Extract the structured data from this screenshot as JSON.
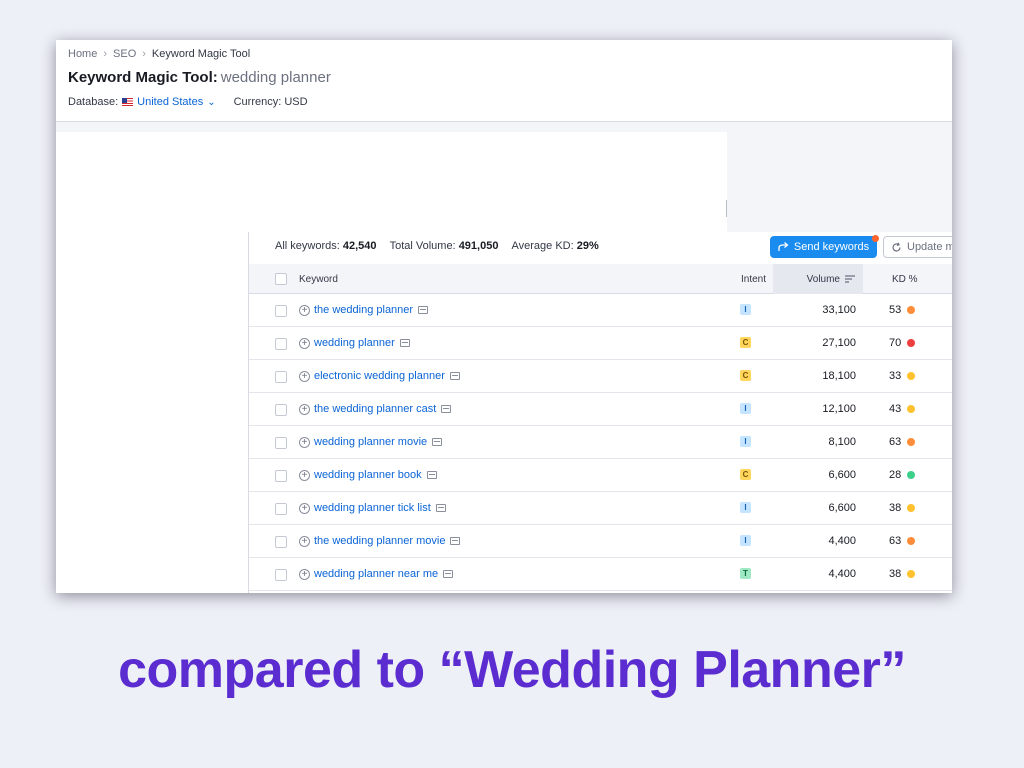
{
  "breadcrumb": [
    "Home",
    "SEO",
    "Keyword Magic Tool"
  ],
  "title": {
    "label": "Keyword Magic Tool:",
    "query": "wedding planner"
  },
  "database": {
    "label": "Database:",
    "value": "United States",
    "currency": "Currency: USD"
  },
  "stats": {
    "all_keywords_label": "All keywords:",
    "all_keywords": "42,540",
    "total_volume_label": "Total Volume:",
    "total_volume": "491,050",
    "avg_kd_label": "Average KD:",
    "avg_kd": "29%"
  },
  "buttons": {
    "send": "Send keywords",
    "update": "Update m"
  },
  "columns": {
    "keyword": "Keyword",
    "intent": "Intent",
    "volume": "Volume",
    "kd": "KD %"
  },
  "rows": [
    {
      "keyword": "the wedding planner",
      "intent": "I",
      "volume": "33,100",
      "kd": "53",
      "kd_color": "#ff8c3a"
    },
    {
      "keyword": "wedding planner",
      "intent": "C",
      "volume": "27,100",
      "kd": "70",
      "kd_color": "#ef3f3f"
    },
    {
      "keyword": "electronic wedding planner",
      "intent": "C",
      "volume": "18,100",
      "kd": "33",
      "kd_color": "#ffc12e"
    },
    {
      "keyword": "the wedding planner cast",
      "intent": "I",
      "volume": "12,100",
      "kd": "43",
      "kd_color": "#ffc12e"
    },
    {
      "keyword": "wedding planner movie",
      "intent": "I",
      "volume": "8,100",
      "kd": "63",
      "kd_color": "#ff8c3a"
    },
    {
      "keyword": "wedding planner book",
      "intent": "C",
      "volume": "6,600",
      "kd": "28",
      "kd_color": "#3ccf8a"
    },
    {
      "keyword": "wedding planner tick list",
      "intent": "I",
      "volume": "6,600",
      "kd": "38",
      "kd_color": "#ffc12e"
    },
    {
      "keyword": "the wedding planner movie",
      "intent": "I",
      "volume": "4,400",
      "kd": "63",
      "kd_color": "#ff8c3a"
    },
    {
      "keyword": "wedding planner near me",
      "intent": "T",
      "volume": "4,400",
      "kd": "38",
      "kd_color": "#ffc12e"
    }
  ],
  "intent_colors": {
    "I": {
      "bg": "#c4e4ff",
      "fg": "#1a64b4"
    },
    "C": {
      "bg": "#ffd55c",
      "fg": "#7a5300"
    },
    "T": {
      "bg": "#9fe8c4",
      "fg": "#0b6b3e"
    }
  },
  "caption": "compared to “Wedding Planner”"
}
